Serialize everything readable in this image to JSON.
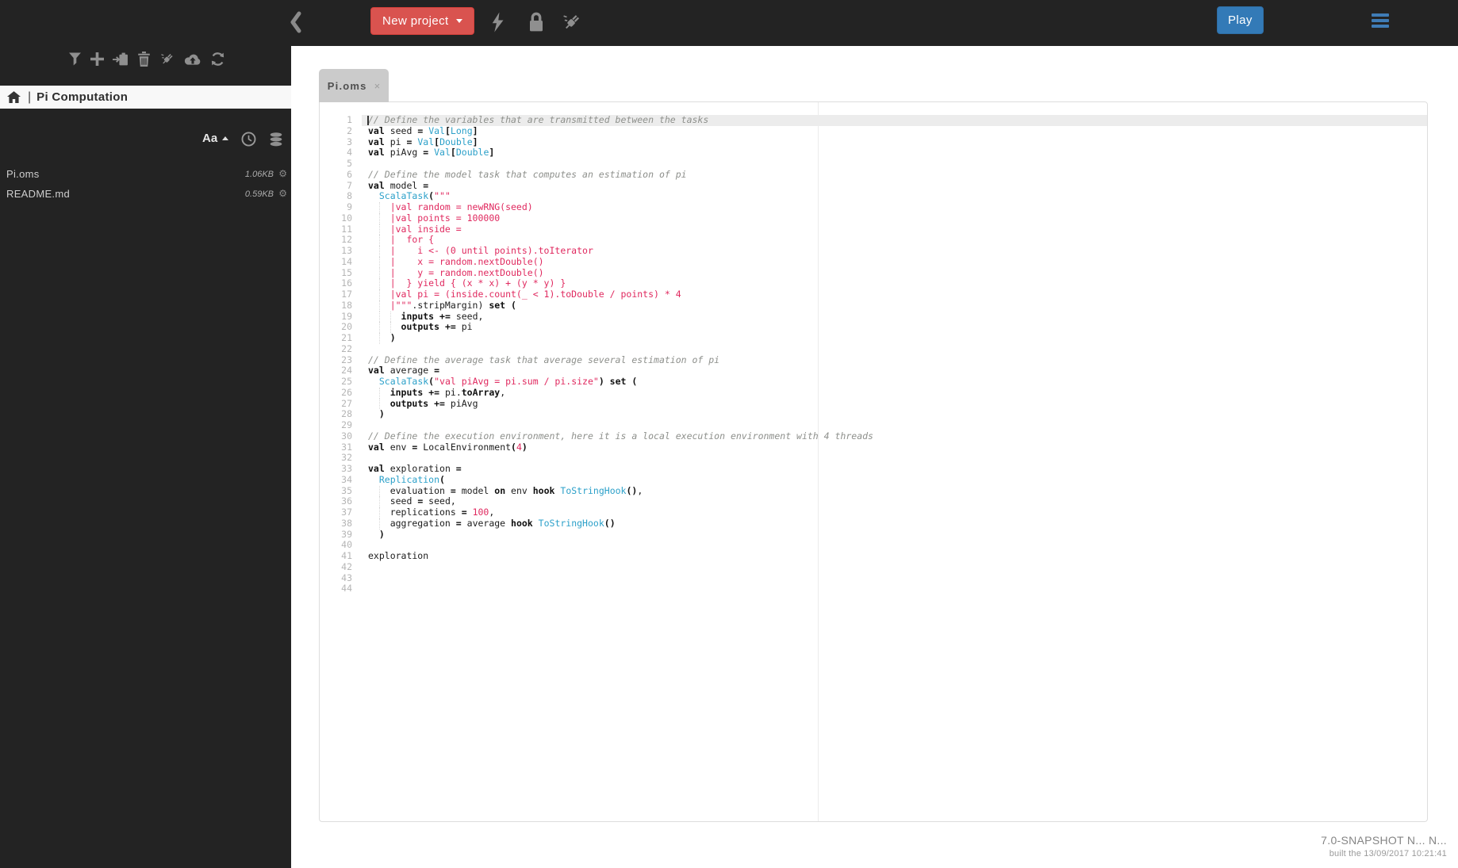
{
  "toolbar": {
    "new_project_label": "New project",
    "play_label": "Play"
  },
  "sidebar": {
    "project_title": "Pi Computation",
    "title_separator": "|",
    "sort_alpha_label": "Aa",
    "files": [
      {
        "name": "Pi.oms",
        "size": "1.06KB",
        "gear": "⚙"
      },
      {
        "name": "README.md",
        "size": "0.59KB",
        "gear": "⚙"
      }
    ]
  },
  "icons": {
    "toolbar": [
      "back-chevron",
      "bolt",
      "lock",
      "plug"
    ],
    "sidebar_toolbar": [
      "filter",
      "add",
      "paste",
      "delete",
      "plug",
      "upload",
      "refresh"
    ],
    "sort_row": [
      "alpha-sort",
      "clock",
      "database"
    ],
    "project_band": [
      "home"
    ],
    "menu": [
      "hamburger"
    ]
  },
  "colors": {
    "dark_bg": "#232323",
    "danger_red": "#d9534f",
    "primary_blue": "#337ab7",
    "tab_gray": "#cbcbcb",
    "string_red": "#e0295f",
    "type_cyan": "#2ba0c9",
    "comment_gray": "#8e908c"
  },
  "editor": {
    "tab_label": "Pi.oms",
    "close_label": "×",
    "active_line": 1,
    "lines": [
      [
        [
          "c",
          "// Define the variables that are transmitted between the tasks"
        ]
      ],
      [
        [
          "k",
          "val"
        ],
        [
          "p",
          " seed "
        ],
        [
          "k",
          "="
        ],
        [
          "p",
          " "
        ],
        [
          "t",
          "Val"
        ],
        [
          "k",
          "["
        ],
        [
          "t",
          "Long"
        ],
        [
          "k",
          "]"
        ]
      ],
      [
        [
          "k",
          "val"
        ],
        [
          "p",
          " pi "
        ],
        [
          "k",
          "="
        ],
        [
          "p",
          " "
        ],
        [
          "t",
          "Val"
        ],
        [
          "k",
          "["
        ],
        [
          "t",
          "Double"
        ],
        [
          "k",
          "]"
        ]
      ],
      [
        [
          "k",
          "val"
        ],
        [
          "p",
          " piAvg "
        ],
        [
          "k",
          "="
        ],
        [
          "p",
          " "
        ],
        [
          "t",
          "Val"
        ],
        [
          "k",
          "["
        ],
        [
          "t",
          "Double"
        ],
        [
          "k",
          "]"
        ]
      ],
      [],
      [
        [
          "c",
          "// Define the model task that computes an estimation of pi"
        ]
      ],
      [
        [
          "k",
          "val"
        ],
        [
          "p",
          " model "
        ],
        [
          "k",
          "="
        ]
      ],
      [
        [
          "p",
          "  "
        ],
        [
          "t",
          "ScalaTask"
        ],
        [
          "k",
          "("
        ],
        [
          "s",
          "\"\"\""
        ]
      ],
      [
        [
          "s",
          "    |val random = newRNG(seed)"
        ]
      ],
      [
        [
          "s",
          "    |val points = 100000"
        ]
      ],
      [
        [
          "s",
          "    |val inside ="
        ]
      ],
      [
        [
          "s",
          "    |  for {"
        ]
      ],
      [
        [
          "s",
          "    |    i <- (0 until points).toIterator"
        ]
      ],
      [
        [
          "s",
          "    |    x = random.nextDouble()"
        ]
      ],
      [
        [
          "s",
          "    |    y = random.nextDouble()"
        ]
      ],
      [
        [
          "s",
          "    |  } yield { (x * x) + (y * y) }"
        ]
      ],
      [
        [
          "s",
          "    |val pi = (inside.count(_ < 1).toDouble / points) * 4"
        ]
      ],
      [
        [
          "s",
          "    |\"\"\""
        ],
        [
          "p",
          ".stripMargin) "
        ],
        [
          "k",
          "set ("
        ]
      ],
      [
        [
          "p",
          "      "
        ],
        [
          "k",
          "inputs"
        ],
        [
          "p",
          " "
        ],
        [
          "k",
          "+="
        ],
        [
          "p",
          " seed,"
        ]
      ],
      [
        [
          "p",
          "      "
        ],
        [
          "k",
          "outputs"
        ],
        [
          "p",
          " "
        ],
        [
          "k",
          "+="
        ],
        [
          "p",
          " pi"
        ]
      ],
      [
        [
          "p",
          "    "
        ],
        [
          "k",
          ")"
        ]
      ],
      [],
      [
        [
          "c",
          "// Define the average task that average several estimation of pi"
        ]
      ],
      [
        [
          "k",
          "val"
        ],
        [
          "p",
          " average "
        ],
        [
          "k",
          "="
        ]
      ],
      [
        [
          "p",
          "  "
        ],
        [
          "t",
          "ScalaTask"
        ],
        [
          "k",
          "("
        ],
        [
          "s",
          "\"val piAvg = pi.sum / pi.size\""
        ],
        [
          "k",
          ") set ("
        ]
      ],
      [
        [
          "p",
          "    "
        ],
        [
          "k",
          "inputs"
        ],
        [
          "p",
          " "
        ],
        [
          "k",
          "+="
        ],
        [
          "p",
          " pi."
        ],
        [
          "k",
          "toArray"
        ],
        [
          "p",
          ","
        ]
      ],
      [
        [
          "p",
          "    "
        ],
        [
          "k",
          "outputs"
        ],
        [
          "p",
          " "
        ],
        [
          "k",
          "+="
        ],
        [
          "p",
          " piAvg"
        ]
      ],
      [
        [
          "p",
          "  "
        ],
        [
          "k",
          ")"
        ]
      ],
      [],
      [
        [
          "c",
          "// Define the execution environment, here it is a local execution environment with 4 threads"
        ]
      ],
      [
        [
          "k",
          "val"
        ],
        [
          "p",
          " env "
        ],
        [
          "k",
          "="
        ],
        [
          "p",
          " LocalEnvironment"
        ],
        [
          "k",
          "("
        ],
        [
          "n",
          "4"
        ],
        [
          "k",
          ")"
        ]
      ],
      [],
      [
        [
          "k",
          "val"
        ],
        [
          "p",
          " exploration "
        ],
        [
          "k",
          "="
        ]
      ],
      [
        [
          "p",
          "  "
        ],
        [
          "t",
          "Replication"
        ],
        [
          "k",
          "("
        ]
      ],
      [
        [
          "p",
          "    evaluation "
        ],
        [
          "k",
          "="
        ],
        [
          "p",
          " model "
        ],
        [
          "k",
          "on"
        ],
        [
          "p",
          " env "
        ],
        [
          "k",
          "hook"
        ],
        [
          "p",
          " "
        ],
        [
          "t",
          "ToStringHook"
        ],
        [
          "k",
          "()"
        ],
        [
          "p",
          ","
        ]
      ],
      [
        [
          "p",
          "    seed "
        ],
        [
          "k",
          "="
        ],
        [
          "p",
          " seed,"
        ]
      ],
      [
        [
          "p",
          "    replications "
        ],
        [
          "k",
          "="
        ],
        [
          "p",
          " "
        ],
        [
          "n",
          "100"
        ],
        [
          "p",
          ","
        ]
      ],
      [
        [
          "p",
          "    aggregation "
        ],
        [
          "k",
          "="
        ],
        [
          "p",
          " average "
        ],
        [
          "k",
          "hook"
        ],
        [
          "p",
          " "
        ],
        [
          "t",
          "ToStringHook"
        ],
        [
          "k",
          "()"
        ]
      ],
      [
        [
          "p",
          "  "
        ],
        [
          "k",
          ")"
        ]
      ],
      [],
      [
        [
          "p",
          "exploration"
        ]
      ],
      [],
      [],
      []
    ]
  },
  "footer": {
    "version": "7.0-SNAPSHOT N... N...",
    "built": "built the 13/09/2017 10:21:41"
  }
}
